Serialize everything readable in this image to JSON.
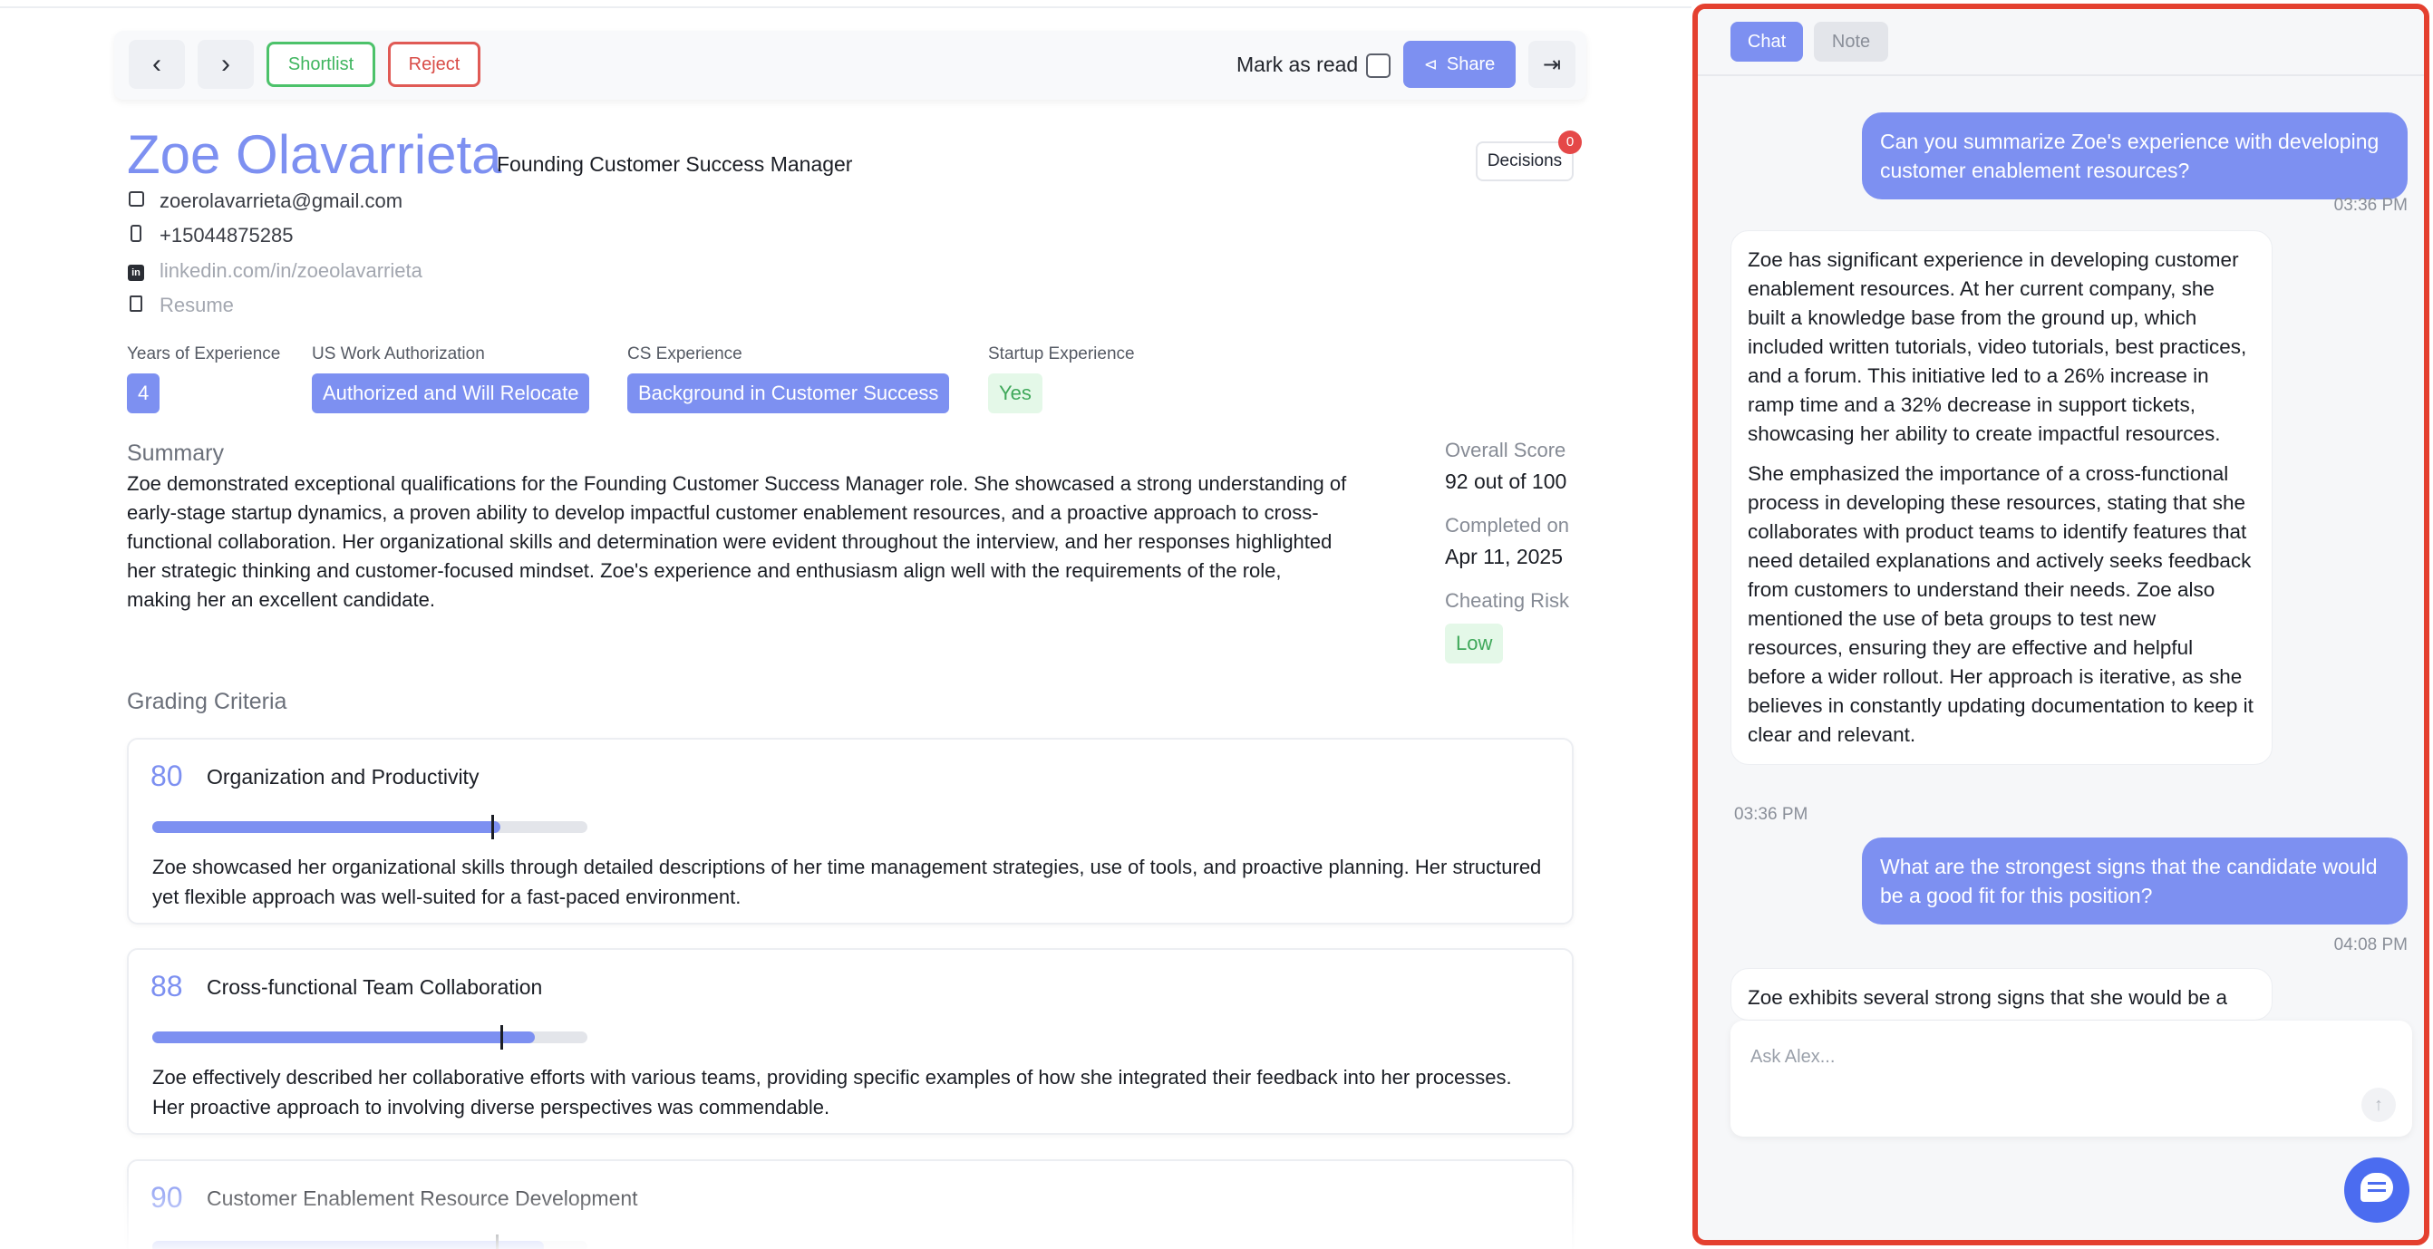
{
  "toolbar": {
    "shortlist_label": "Shortlist",
    "reject_label": "Reject",
    "mark_read_label": "Mark as read",
    "share_label": "Share"
  },
  "candidate": {
    "name": "Zoe Olavarrieta",
    "role": "Founding Customer Success Manager",
    "email": "zoerolavarrieta@gmail.com",
    "phone": "+15044875285",
    "linkedin": "linkedin.com/in/zoeolavarrieta",
    "resume_label": "Resume"
  },
  "decisions": {
    "label": "Decisions",
    "count": "0"
  },
  "attributes": [
    {
      "label": "Years of Experience",
      "value": "4"
    },
    {
      "label": "US Work Authorization",
      "value": "Authorized and Will Relocate"
    },
    {
      "label": "CS Experience",
      "value": "Background in Customer Success"
    },
    {
      "label": "Startup Experience",
      "value": "Yes"
    }
  ],
  "summary": {
    "label": "Summary",
    "text": "Zoe demonstrated exceptional qualifications for the Founding Customer Success Manager role. She showcased a strong understanding of early-stage startup dynamics, a proven ability to develop impactful customer enablement resources, and a proactive approach to cross-functional collaboration. Her organizational skills and determination were evident throughout the interview, and her responses highlighted her strategic thinking and customer-focused mindset. Zoe's experience and enthusiasm align well with the requirements of the role, making her an excellent candidate."
  },
  "scores": {
    "overall_label": "Overall Score",
    "overall_value": "92 out of 100",
    "completed_label": "Completed on",
    "completed_value": "Apr 11, 2025",
    "risk_label": "Cheating Risk",
    "risk_value": "Low"
  },
  "grading": {
    "label": "Grading Criteria",
    "criteria": [
      {
        "score": "80",
        "title": "Organization and Productivity",
        "fill": 0.8,
        "marker": 0.78,
        "description": "Zoe showcased her organizational skills through detailed descriptions of her time management strategies, use of tools, and proactive planning. Her structured yet flexible approach was well-suited for a fast-paced environment."
      },
      {
        "score": "88",
        "title": "Cross-functional Team Collaboration",
        "fill": 0.88,
        "marker": 0.8,
        "description": "Zoe effectively described her collaborative efforts with various teams, providing specific examples of how she integrated their feedback into her processes. Her proactive approach to involving diverse perspectives was commendable."
      },
      {
        "score": "90",
        "title": "Customer Enablement Resource Development",
        "fill": 0.9,
        "marker": 0.79,
        "description": ""
      }
    ]
  },
  "chat": {
    "tabs": [
      "Chat",
      "Note"
    ],
    "messages": [
      {
        "role": "user",
        "text": "Can you summarize Zoe's experience with developing customer enablement resources?",
        "time": "03:36 PM"
      },
      {
        "role": "assistant",
        "p1": "Zoe has significant experience in developing customer enablement resources. At her current company, she built a knowledge base from the ground up, which included written tutorials, video tutorials, best practices, and a forum. This initiative led to a 26% increase in ramp time and a 32% decrease in support tickets, showcasing her ability to create impactful resources.",
        "p2": "She emphasized the importance of a cross-functional process in developing these resources, stating that she collaborates with product teams to identify features that need detailed explanations and actively seeks feedback from customers to understand their needs. Zoe also mentioned the use of beta groups to test new resources, ensuring they are effective and helpful before a wider rollout. Her approach is iterative, as she believes in constantly updating documentation to keep it clear and relevant.",
        "time": "03:36 PM"
      },
      {
        "role": "user",
        "text": "What are the strongest signs that the candidate would be a good fit for this position?",
        "time": "04:08 PM"
      },
      {
        "role": "assistant",
        "p1": "Zoe exhibits several strong signs that she would be a"
      }
    ],
    "input_placeholder": "Ask Alex..."
  },
  "colors": {
    "accent": "#7d90f1",
    "shortlist": "#4cc26a",
    "reject": "#e05a55",
    "highlight_border": "#e4402f",
    "help_bubble": "#4b6cf0"
  },
  "icons": {
    "prev": "chevron-left-icon",
    "next": "chevron-right-icon",
    "share": "share-icon",
    "collapse": "collapse-panel-icon",
    "email": "mail-icon",
    "phone": "phone-icon",
    "linkedin": "linkedin-icon",
    "resume": "document-icon",
    "send": "arrow-up-icon",
    "help": "chat-bubble-icon"
  }
}
